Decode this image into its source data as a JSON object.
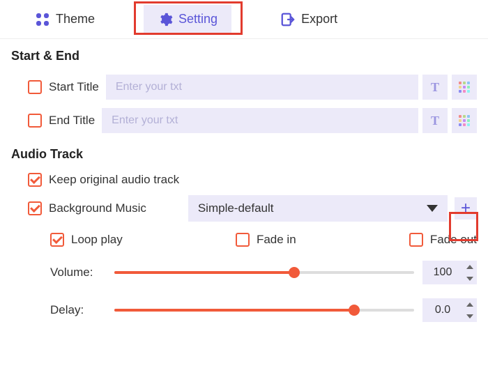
{
  "tabs": {
    "theme": "Theme",
    "setting": "Setting",
    "export": "Export"
  },
  "sections": {
    "startEnd": "Start & End",
    "audioTrack": "Audio Track"
  },
  "startTitle": {
    "label": "Start Title",
    "placeholder": "Enter your txt",
    "checked": false
  },
  "endTitle": {
    "label": "End Title",
    "placeholder": "Enter your txt",
    "checked": false
  },
  "keepOriginal": {
    "label": "Keep original audio track",
    "checked": true
  },
  "bgMusic": {
    "label": "Background Music",
    "checked": true,
    "selected": "Simple-default"
  },
  "loopPlay": {
    "label": "Loop play",
    "checked": true
  },
  "fadeIn": {
    "label": "Fade in",
    "checked": false
  },
  "fadeOut": {
    "label": "Fade out",
    "checked": false
  },
  "volume": {
    "label": "Volume:",
    "value": "100",
    "percent": 60
  },
  "delay": {
    "label": "Delay:",
    "value": "0.0",
    "percent": 80
  }
}
